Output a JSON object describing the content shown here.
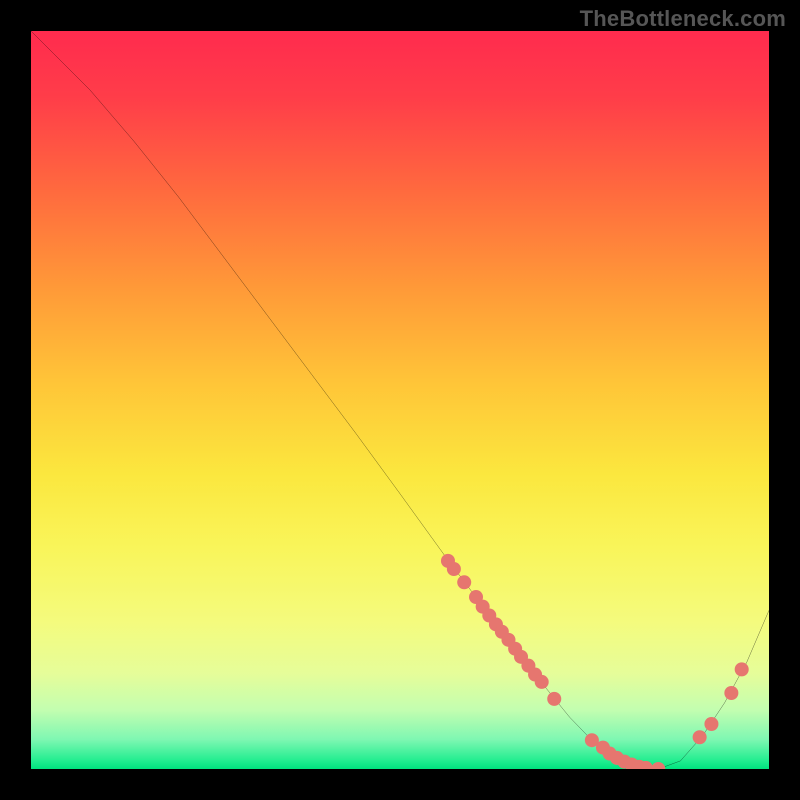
{
  "attribution": "TheBottleneck.com",
  "colors": {
    "dot_fill": "#e6766f",
    "curve_stroke": "#000000"
  },
  "chart_data": {
    "type": "line",
    "title": "",
    "xlabel": "",
    "ylabel": "",
    "xlim": [
      0,
      100
    ],
    "ylim": [
      0,
      100
    ],
    "curve": {
      "x": [
        0,
        3,
        8,
        14,
        20,
        26,
        32,
        38,
        44,
        50,
        56,
        59,
        62,
        66,
        70,
        73,
        76,
        79,
        82,
        85,
        88,
        91,
        94,
        97,
        100
      ],
      "y": [
        100,
        97,
        92,
        85,
        77.5,
        69.5,
        61.5,
        53.5,
        45.5,
        37.3,
        29,
        25,
        21,
        15.8,
        10.7,
        7,
        3.9,
        1.7,
        0.5,
        0,
        1.1,
        4.5,
        9.0,
        14.5,
        21.5
      ]
    },
    "marker_points": {
      "x": [
        56.5,
        57.3,
        58.7,
        60.3,
        61.2,
        62.1,
        63.0,
        63.8,
        64.7,
        65.6,
        66.4,
        67.4,
        68.3,
        69.2,
        70.9,
        76.0,
        77.5,
        78.4,
        79.4,
        80.4,
        81.4,
        82.4,
        83.3,
        85.0,
        90.6,
        92.2,
        94.9,
        96.3
      ],
      "y": [
        28.2,
        27.1,
        25.3,
        23.3,
        22.0,
        20.8,
        19.6,
        18.6,
        17.5,
        16.3,
        15.2,
        14.0,
        12.8,
        11.8,
        9.5,
        3.9,
        2.9,
        2.1,
        1.5,
        1.0,
        0.6,
        0.3,
        0.15,
        0.0,
        4.3,
        6.1,
        10.3,
        13.5
      ]
    }
  }
}
